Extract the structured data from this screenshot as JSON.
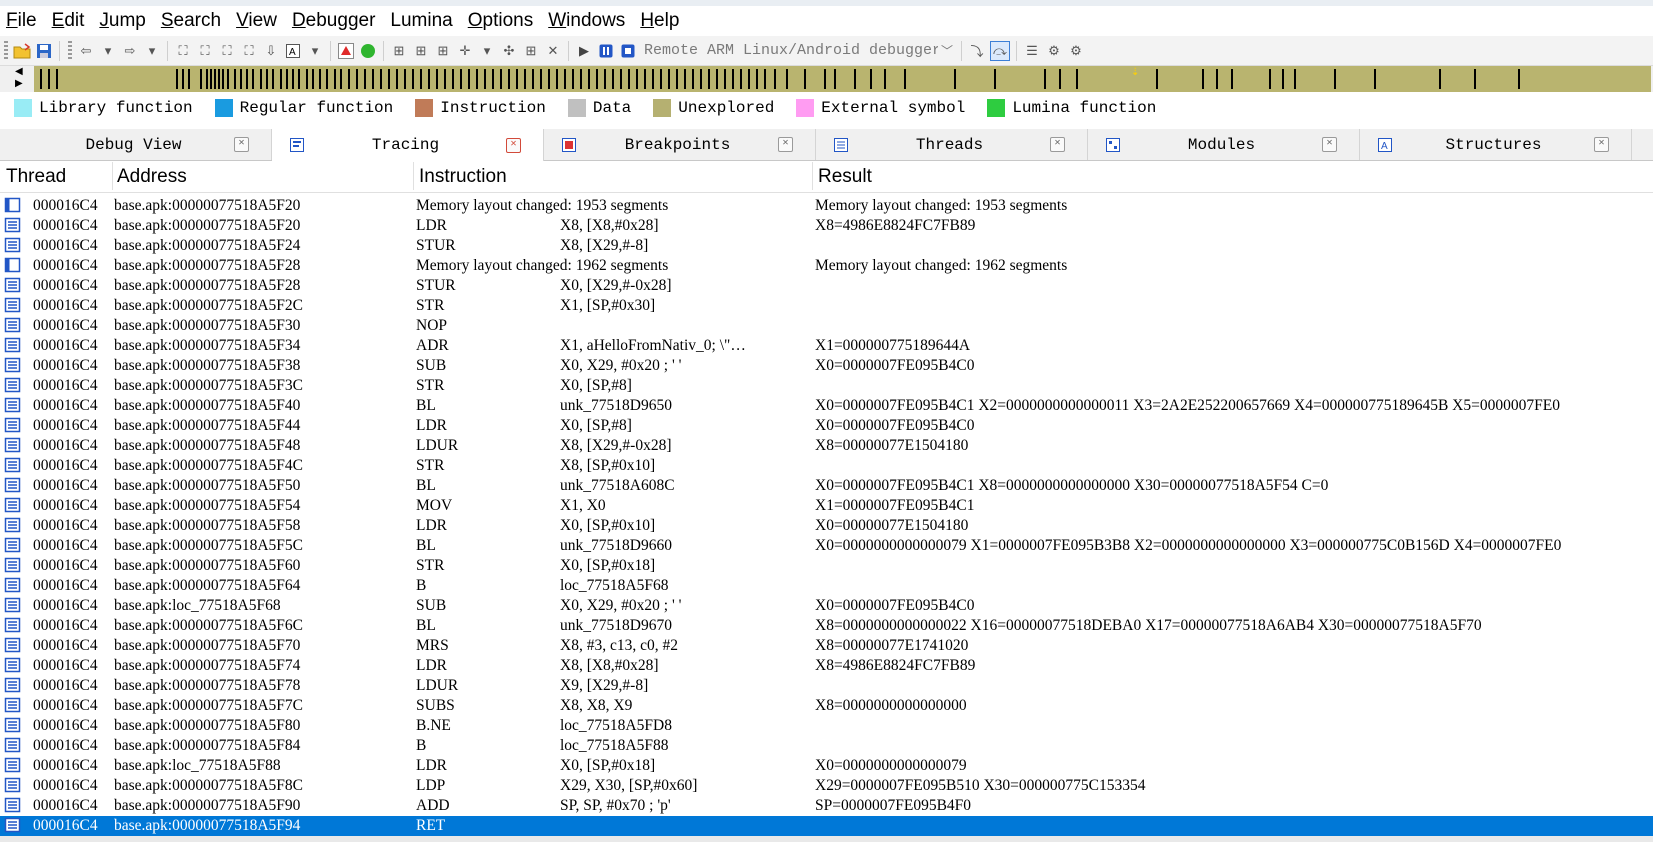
{
  "menu": [
    {
      "label": "File",
      "key": "F",
      "rest": "ile"
    },
    {
      "label": "Edit",
      "key": "E",
      "rest": "dit"
    },
    {
      "label": "Jump",
      "key": "J",
      "rest": "ump"
    },
    {
      "label": "Search",
      "key": "S",
      "rest": "earch"
    },
    {
      "label": "View",
      "key": "V",
      "rest": "iew"
    },
    {
      "label": "Debugger",
      "key": "D",
      "rest": "ebugger"
    },
    {
      "label": "Lumina",
      "key": "",
      "rest": "Lumina"
    },
    {
      "label": "Options",
      "key": "O",
      "rest": "ptions"
    },
    {
      "label": "Windows",
      "key": "W",
      "rest": "indows"
    },
    {
      "label": "Help",
      "key": "H",
      "rest": "elp"
    }
  ],
  "toolbar": {
    "debugger_select": "Remote ARM Linux/Android debugger"
  },
  "legend": [
    {
      "label": "Library function",
      "color": "#99ecf5"
    },
    {
      "label": "Regular function",
      "color": "#1a9be0"
    },
    {
      "label": "Instruction",
      "color": "#c07b58"
    },
    {
      "label": "Data",
      "color": "#c0c0c0"
    },
    {
      "label": "Unexplored",
      "color": "#b5b071"
    },
    {
      "label": "External symbol",
      "color": "#ff9cf2"
    },
    {
      "label": "Lumina function",
      "color": "#2ecc40"
    }
  ],
  "tabs": [
    {
      "label": "Debug View",
      "icon": "debug-view-icon",
      "active": false
    },
    {
      "label": "Tracing",
      "icon": "tracing-icon",
      "active": true
    },
    {
      "label": "Breakpoints",
      "icon": "breakpoints-icon",
      "active": false
    },
    {
      "label": "Threads",
      "icon": "threads-icon",
      "active": false
    },
    {
      "label": "Modules",
      "icon": "modules-icon",
      "active": false
    },
    {
      "label": "Structures",
      "icon": "structures-icon",
      "active": false
    }
  ],
  "table": {
    "columns": [
      "Thread",
      "Address",
      "Instruction",
      "Result"
    ],
    "rows": [
      {
        "thread": "000016C4",
        "address": "base.apk:00000077518A5F20",
        "line": "Memory layout changed: 1953 segments",
        "mnemonic": "",
        "operands": "",
        "result": "Memory layout changed: 1953 segments",
        "event": true
      },
      {
        "thread": "000016C4",
        "address": "base.apk:00000077518A5F20",
        "mnemonic": "LDR",
        "operands": "X8, [X8,#0x28]",
        "result": "X8=4986E8824FC7FB89"
      },
      {
        "thread": "000016C4",
        "address": "base.apk:00000077518A5F24",
        "mnemonic": "STUR",
        "operands": "X8, [X29,#-8]",
        "result": ""
      },
      {
        "thread": "000016C4",
        "address": "base.apk:00000077518A5F28",
        "line": "Memory layout changed: 1962 segments",
        "mnemonic": "",
        "operands": "",
        "result": "Memory layout changed: 1962 segments",
        "event": true
      },
      {
        "thread": "000016C4",
        "address": "base.apk:00000077518A5F28",
        "mnemonic": "STUR",
        "operands": "X0, [X29,#-0x28]",
        "result": ""
      },
      {
        "thread": "000016C4",
        "address": "base.apk:00000077518A5F2C",
        "mnemonic": "STR",
        "operands": "X1, [SP,#0x30]",
        "result": ""
      },
      {
        "thread": "000016C4",
        "address": "base.apk:00000077518A5F30",
        "mnemonic": "NOP",
        "operands": "",
        "result": ""
      },
      {
        "thread": "000016C4",
        "address": "base.apk:00000077518A5F34",
        "mnemonic": "ADR",
        "operands": "X1, aHelloFromNativ_0; \\\"…",
        "result": "X1=000000775189644A"
      },
      {
        "thread": "000016C4",
        "address": "base.apk:00000077518A5F38",
        "mnemonic": "SUB",
        "operands": "X0, X29, #0x20 ; ' '",
        "result": "X0=0000007FE095B4C0"
      },
      {
        "thread": "000016C4",
        "address": "base.apk:00000077518A5F3C",
        "mnemonic": "STR",
        "operands": "X0, [SP,#8]",
        "result": ""
      },
      {
        "thread": "000016C4",
        "address": "base.apk:00000077518A5F40",
        "mnemonic": "BL",
        "operands": "unk_77518D9650",
        "result": "X0=0000007FE095B4C1 X2=0000000000000011 X3=2A2E252200657669 X4=000000775189645B X5=0000007FE0"
      },
      {
        "thread": "000016C4",
        "address": "base.apk:00000077518A5F44",
        "mnemonic": "LDR",
        "operands": "X0, [SP,#8]",
        "result": "X0=0000007FE095B4C0"
      },
      {
        "thread": "000016C4",
        "address": "base.apk:00000077518A5F48",
        "mnemonic": "LDUR",
        "operands": "X8, [X29,#-0x28]",
        "result": "X8=00000077E1504180"
      },
      {
        "thread": "000016C4",
        "address": "base.apk:00000077518A5F4C",
        "mnemonic": "STR",
        "operands": "X8, [SP,#0x10]",
        "result": ""
      },
      {
        "thread": "000016C4",
        "address": "base.apk:00000077518A5F50",
        "mnemonic": "BL",
        "operands": "unk_77518A608C",
        "result": "X0=0000007FE095B4C1 X8=0000000000000000 X30=00000077518A5F54 C=0"
      },
      {
        "thread": "000016C4",
        "address": "base.apk:00000077518A5F54",
        "mnemonic": "MOV",
        "operands": "X1, X0",
        "result": "X1=0000007FE095B4C1"
      },
      {
        "thread": "000016C4",
        "address": "base.apk:00000077518A5F58",
        "mnemonic": "LDR",
        "operands": "X0, [SP,#0x10]",
        "result": "X0=00000077E1504180"
      },
      {
        "thread": "000016C4",
        "address": "base.apk:00000077518A5F5C",
        "mnemonic": "BL",
        "operands": "unk_77518D9660",
        "result": "X0=0000000000000079 X1=0000007FE095B3B8 X2=0000000000000000 X3=000000775C0B156D X4=0000007FE0"
      },
      {
        "thread": "000016C4",
        "address": "base.apk:00000077518A5F60",
        "mnemonic": "STR",
        "operands": "X0, [SP,#0x18]",
        "result": ""
      },
      {
        "thread": "000016C4",
        "address": "base.apk:00000077518A5F64",
        "mnemonic": "B",
        "operands": "loc_77518A5F68",
        "result": ""
      },
      {
        "thread": "000016C4",
        "address": "base.apk:loc_77518A5F68",
        "mnemonic": "SUB",
        "operands": "X0, X29, #0x20 ; ' '",
        "result": "X0=0000007FE095B4C0"
      },
      {
        "thread": "000016C4",
        "address": "base.apk:00000077518A5F6C",
        "mnemonic": "BL",
        "operands": "unk_77518D9670",
        "result": "X8=0000000000000022 X16=00000077518DEBA0 X17=00000077518A6AB4 X30=00000077518A5F70"
      },
      {
        "thread": "000016C4",
        "address": "base.apk:00000077518A5F70",
        "mnemonic": "MRS",
        "operands": "X8, #3, c13, c0, #2",
        "result": "X8=00000077E1741020"
      },
      {
        "thread": "000016C4",
        "address": "base.apk:00000077518A5F74",
        "mnemonic": "LDR",
        "operands": "X8, [X8,#0x28]",
        "result": "X8=4986E8824FC7FB89"
      },
      {
        "thread": "000016C4",
        "address": "base.apk:00000077518A5F78",
        "mnemonic": "LDUR",
        "operands": "X9, [X29,#-8]",
        "result": ""
      },
      {
        "thread": "000016C4",
        "address": "base.apk:00000077518A5F7C",
        "mnemonic": "SUBS",
        "operands": "X8, X8, X9",
        "result": "X8=0000000000000000"
      },
      {
        "thread": "000016C4",
        "address": "base.apk:00000077518A5F80",
        "mnemonic": "B.NE",
        "operands": "loc_77518A5FD8",
        "result": ""
      },
      {
        "thread": "000016C4",
        "address": "base.apk:00000077518A5F84",
        "mnemonic": "B",
        "operands": "loc_77518A5F88",
        "result": ""
      },
      {
        "thread": "000016C4",
        "address": "base.apk:loc_77518A5F88",
        "mnemonic": "LDR",
        "operands": "X0, [SP,#0x18]",
        "result": "X0=0000000000000079"
      },
      {
        "thread": "000016C4",
        "address": "base.apk:00000077518A5F8C",
        "mnemonic": "LDP",
        "operands": "X29, X30, [SP,#0x60]",
        "result": "X29=0000007FE095B510 X30=000000775C153354"
      },
      {
        "thread": "000016C4",
        "address": "base.apk:00000077518A5F90",
        "mnemonic": "ADD",
        "operands": "SP, SP, #0x70 ; 'p'",
        "result": "SP=0000007FE095B4F0"
      },
      {
        "thread": "000016C4",
        "address": "base.apk:00000077518A5F94",
        "mnemonic": "RET",
        "operands": "",
        "result": "",
        "selected": true
      }
    ]
  }
}
